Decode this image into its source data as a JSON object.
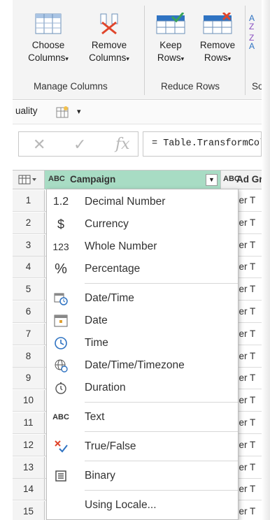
{
  "ribbon": {
    "choose_columns": {
      "line1": "Choose",
      "line2": "Columns"
    },
    "remove_columns": {
      "line1": "Remove",
      "line2": "Columns"
    },
    "keep_rows": {
      "line1": "Keep",
      "line2": "Rows"
    },
    "remove_rows": {
      "line1": "Remove",
      "line2": "Rows"
    },
    "group_manage": "Manage Columns",
    "group_reduce": "Reduce Rows",
    "group_sort_partial": "So",
    "caret": "▾"
  },
  "quality": {
    "label": "uality",
    "caret": "▾"
  },
  "formula": {
    "cancel": "✕",
    "confirm": "✓",
    "fx": "fx",
    "text": "= Table.TransformColumnTypes"
  },
  "grid": {
    "header_campaign": "Campaign",
    "header_adgroup": "Ad Gr",
    "abc": "ABC",
    "rows": [
      "1",
      "2",
      "3",
      "4",
      "5",
      "6",
      "7",
      "8",
      "9",
      "10",
      "11",
      "12",
      "13",
      "14",
      "15"
    ],
    "cell_partial": "ber T"
  },
  "menu": {
    "items": [
      {
        "label": "Decimal Number",
        "icon": "1.2"
      },
      {
        "label": "Currency",
        "icon": "$"
      },
      {
        "label": "Whole Number",
        "icon": "123"
      },
      {
        "label": "Percentage",
        "icon": "%"
      },
      {
        "label": "Date/Time",
        "icon": "datetime-icon"
      },
      {
        "label": "Date",
        "icon": "calendar-icon"
      },
      {
        "label": "Time",
        "icon": "clock-icon"
      },
      {
        "label": "Date/Time/Timezone",
        "icon": "globe-clock-icon"
      },
      {
        "label": "Duration",
        "icon": "stopwatch-icon"
      },
      {
        "label": "Text",
        "icon": "ABC"
      },
      {
        "label": "True/False",
        "icon": "true-false-icon"
      },
      {
        "label": "Binary",
        "icon": "binary-icon"
      },
      {
        "label": "Using Locale...",
        "icon": ""
      }
    ]
  },
  "colors": {
    "accent_green": "#a8dcc4",
    "icon_blue": "#2f73c2",
    "icon_red": "#e0452b",
    "check_green": "#3aa35a"
  }
}
